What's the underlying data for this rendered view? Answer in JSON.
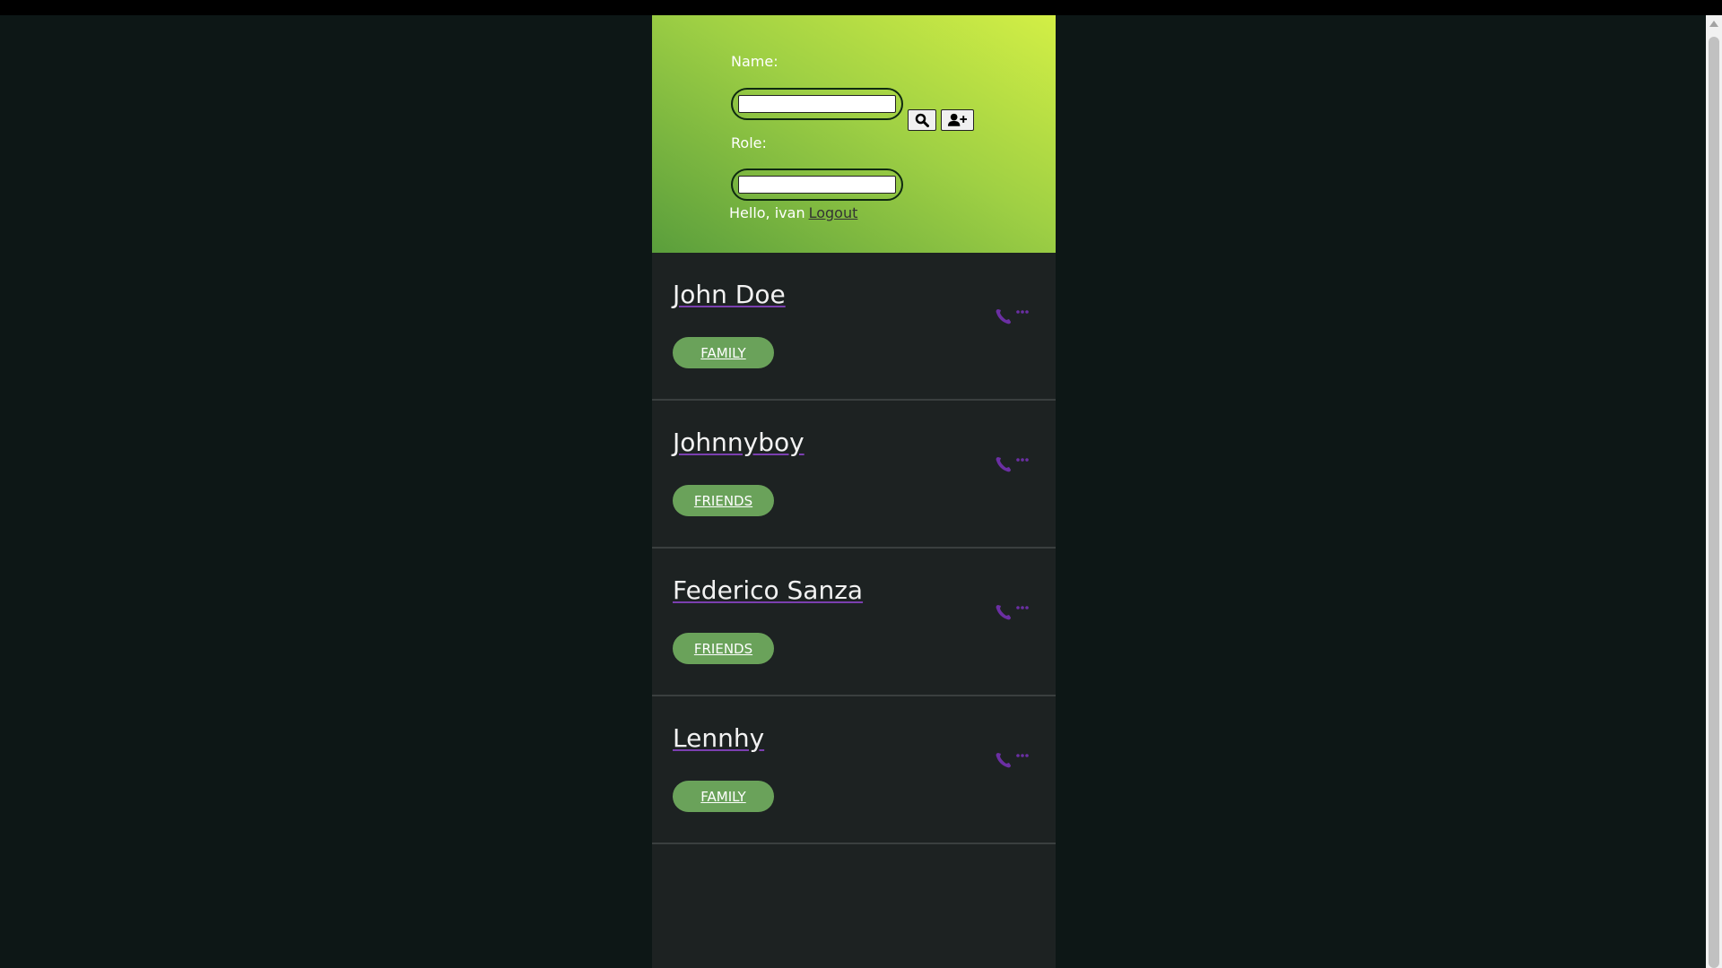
{
  "header": {
    "name_label": "Name:",
    "name_value": "",
    "role_label": "Role:",
    "role_value": "",
    "greeting": "Hello, ivan",
    "logout_label": "Logout"
  },
  "contacts": [
    {
      "name": "John Doe",
      "tag": "FAMILY"
    },
    {
      "name": "Johnnyboy",
      "tag": "FRIENDS"
    },
    {
      "name": "Federico Sanza",
      "tag": "FRIENDS"
    },
    {
      "name": "Lennhy",
      "tag": "FAMILY"
    }
  ],
  "colors": {
    "accent_purple": "#6b2fa3",
    "tag_green": "#6aa25a",
    "header_gradient": [
      "#5a9e3c",
      "#d3ef45"
    ]
  },
  "icons": [
    "search-icon",
    "add-user-icon",
    "phone-icon",
    "more-icon"
  ]
}
